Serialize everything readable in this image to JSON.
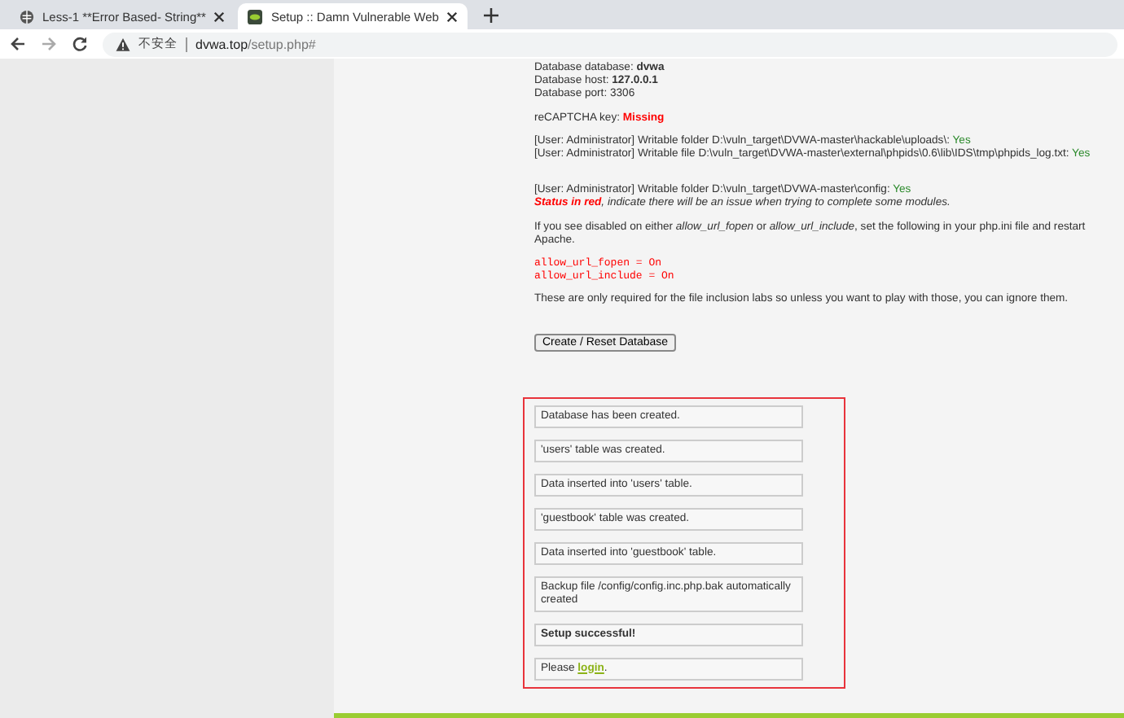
{
  "tabs": [
    {
      "label": "Less-1 **Error Based- String**",
      "selected": false
    },
    {
      "label": "Setup :: Damn Vulnerable Web",
      "selected": true
    }
  ],
  "address_bar": {
    "security_label": "不安全",
    "host": "dvwa.top",
    "path": "/setup.php#"
  },
  "config": [
    {
      "label": "Database database: ",
      "value": "dvwa",
      "kind": "bold"
    },
    {
      "label": "Database host: ",
      "value": "127.0.0.1",
      "kind": "bold"
    },
    {
      "label": "Database port: ",
      "value": "3306",
      "kind": "plain"
    }
  ],
  "recaptcha": {
    "label": "reCAPTCHA key: ",
    "value": "Missing"
  },
  "writable_checks": [
    {
      "label": "[User: Administrator] Writable folder D:\\vuln_target\\DVWA-master\\hackable\\uploads\\: ",
      "value": "Yes",
      "ok": true
    },
    {
      "label": "[User: Administrator] Writable file D:\\vuln_target\\DVWA-master\\external\\phpids\\0.6\\lib\\IDS\\tmp\\phpids_log.txt: ",
      "value": "Yes",
      "ok": true
    }
  ],
  "config_check": {
    "label": "[User: Administrator] Writable folder D:\\vuln_target\\DVWA-master\\config: ",
    "value": "Yes",
    "ok": true
  },
  "status_note": {
    "emphasis": "Status in red",
    "text": ", indicate there will be an issue when trying to complete some modules."
  },
  "info_paragraph": "If you see disabled on either *allow_url_fopen* or *allow_url_include*, set the following in your php.ini file and restart Apache.",
  "code_lines": [
    "allow_url_fopen = On",
    "allow_url_include = On"
  ],
  "note_paragraph": "These are only required for the file inclusion labs so unless you want to play with those, you can ignore them.",
  "button": "Create / Reset Database",
  "messages": [
    {
      "kind": "plain",
      "text": "Database has been created."
    },
    {
      "kind": "plain",
      "text": "'users' table was created."
    },
    {
      "kind": "plain",
      "text": "Data inserted into 'users' table."
    },
    {
      "kind": "plain",
      "text": "'guestbook' table was created."
    },
    {
      "kind": "plain",
      "text": "Data inserted into 'guestbook' table."
    },
    {
      "kind": "plain",
      "text": "Backup file /config/config.inc.php.bak automatically created"
    },
    {
      "kind": "bold",
      "text": "Setup successful!"
    },
    {
      "kind": "link",
      "text": "Please ",
      "link": "login",
      "after": "."
    }
  ]
}
